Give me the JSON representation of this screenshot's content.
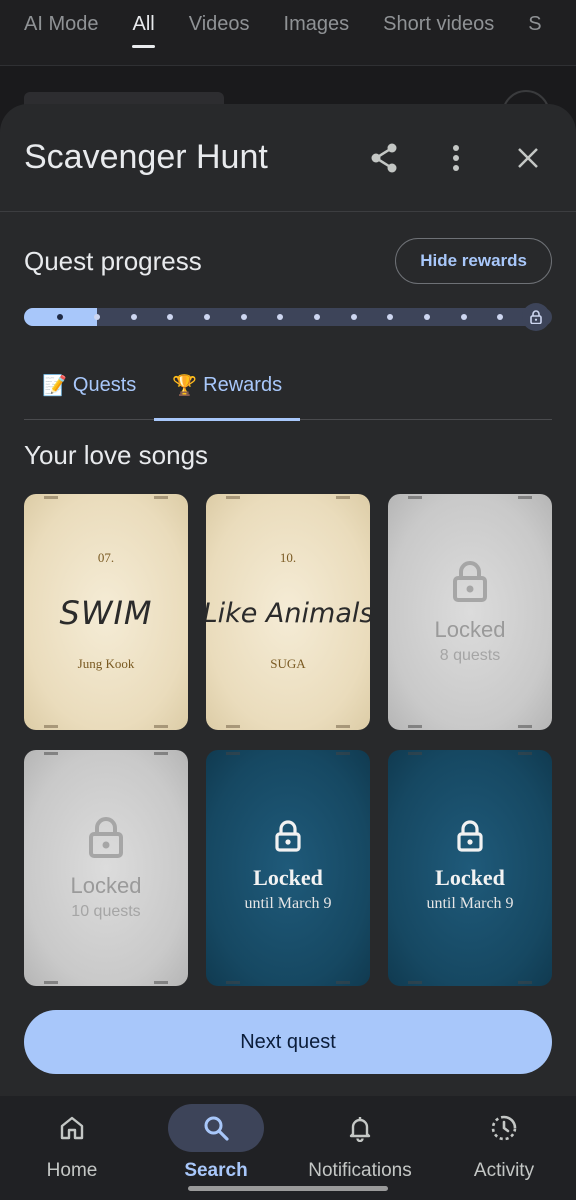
{
  "top_tabs": [
    "AI Mode",
    "All",
    "Videos",
    "Images",
    "Short videos",
    "S"
  ],
  "active_top_tab": "All",
  "sheet": {
    "title": "Scavenger Hunt",
    "icons": [
      "share-icon",
      "more-vert-icon",
      "close-icon"
    ]
  },
  "progress": {
    "title": "Quest progress",
    "hide_rewards_label": "Hide rewards",
    "completed_fraction": 0.14,
    "total_steps": 14,
    "completed_steps": 2
  },
  "tabs": [
    {
      "emoji": "📝",
      "label": "Quests",
      "active": false
    },
    {
      "emoji": "🏆",
      "label": "Rewards",
      "active": true
    }
  ],
  "section_title": "Your love songs",
  "cards": [
    {
      "type": "unlocked",
      "number": "07.",
      "song": "SWIM",
      "artist": "Jung Kook"
    },
    {
      "type": "unlocked",
      "number": "10.",
      "song": "Like Animals",
      "artist": "SUGA"
    },
    {
      "type": "locked-grey",
      "locked_label": "Locked",
      "sub": "8 quests"
    },
    {
      "type": "locked-grey",
      "locked_label": "Locked",
      "sub": "10 quests"
    },
    {
      "type": "locked-blue",
      "locked_label": "Locked",
      "sub": "until March 9"
    },
    {
      "type": "locked-blue",
      "locked_label": "Locked",
      "sub": "until March 9"
    }
  ],
  "next_button_label": "Next quest",
  "bottom_nav": [
    {
      "label": "Home",
      "icon": "home-icon",
      "active": false
    },
    {
      "label": "Search",
      "icon": "search-icon",
      "active": true
    },
    {
      "label": "Notifications",
      "icon": "bell-icon",
      "active": false
    },
    {
      "label": "Activity",
      "icon": "activity-icon",
      "active": false
    }
  ],
  "colors": {
    "accent": "#a8c7fa",
    "sheet_bg": "#28292b",
    "card_blue": "#164862",
    "card_paper": "#eadcbc"
  }
}
